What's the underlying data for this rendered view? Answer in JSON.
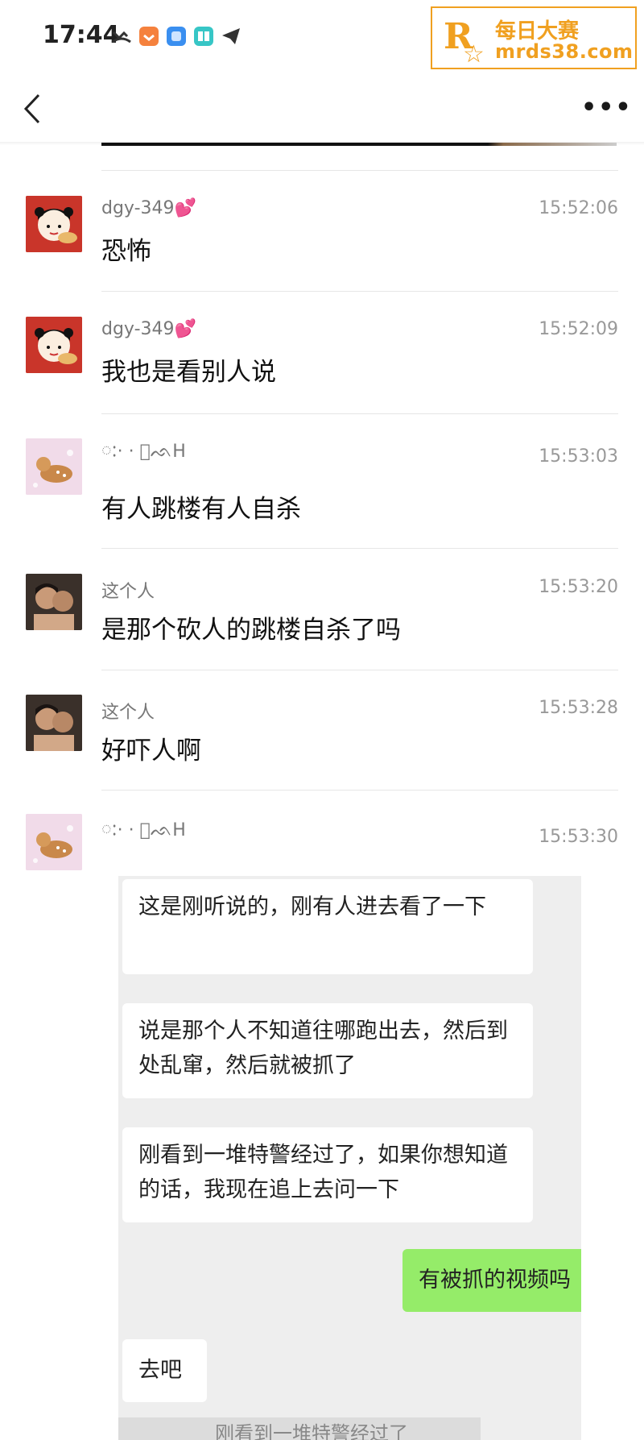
{
  "status_bar": {
    "time": "17:44",
    "icons": [
      "missed-call-icon",
      "orange-app-icon",
      "blue-app-icon",
      "teal-book-icon",
      "telegram-icon",
      "wifi-icon",
      "battery-icon"
    ]
  },
  "watermark": {
    "logo_letter": "R",
    "line1": "每日大赛",
    "line2": "mrds38.com"
  },
  "nav": {
    "back_icon": "chevron-left-icon",
    "more_label": "•••"
  },
  "messages": [
    {
      "name": "dgy-349💕",
      "time": "15:52:06",
      "text": "恐怖",
      "avatar": "girl-avatar"
    },
    {
      "name": "dgy-349💕",
      "time": "15:52:09",
      "text": "我也是看别人说",
      "avatar": "girl-avatar"
    },
    {
      "name": "ៈ· · ᪲ᨒH",
      "time": "15:53:03",
      "text": "有人跳楼有人自杀",
      "avatar": "deer-avatar"
    },
    {
      "name": "这个人",
      "time": "15:53:20",
      "text": "是那个砍人的跳楼自杀了吗",
      "avatar": "couple-avatar"
    },
    {
      "name": "这个人",
      "time": "15:53:28",
      "text": "好吓人啊",
      "avatar": "couple-avatar"
    },
    {
      "name": "ៈ· · ᪲ᨒH",
      "time": "15:53:30",
      "text": "",
      "avatar": "deer-avatar"
    }
  ],
  "embedded_chat": {
    "bubbles": [
      {
        "text": "这是刚听说的，刚有人进去看了一下",
        "side": "left"
      },
      {
        "text": "说是那个人不知道往哪跑出去，然后到处乱窜，然后就被抓了",
        "side": "left"
      },
      {
        "text": "刚看到一堆特警经过了，如果你想知道的话，我现在追上去问一下",
        "side": "left"
      },
      {
        "text": "有被抓的视频吗",
        "side": "right"
      },
      {
        "text": "去吧",
        "side": "left"
      }
    ],
    "quote": "刚看到一堆特警经过了"
  }
}
